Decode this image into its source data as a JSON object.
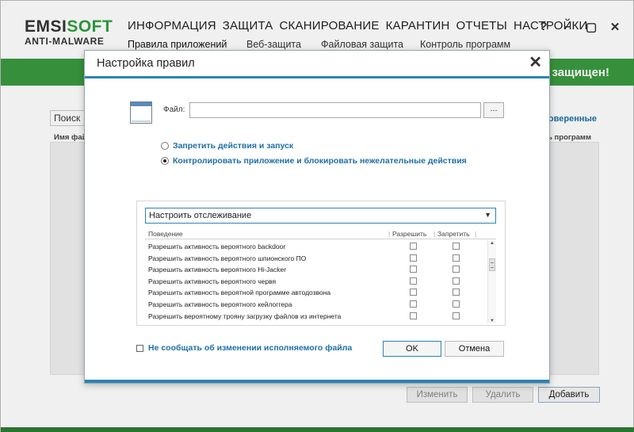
{
  "app": {
    "logo_main_a": "EMSI",
    "logo_main_b": "SOFT",
    "logo_sub": "ANTI-MALWARE",
    "main_nav": [
      "ИНФОРМАЦИЯ",
      "ЗАЩИТА",
      "СКАНИРОВАНИЕ",
      "КАРАНТИН",
      "ОТЧЕТЫ",
      "НАСТРОЙКИ"
    ],
    "sub_nav": [
      "Правила приложений",
      "Веб-защита",
      "Файловая защита",
      "Контроль программ"
    ],
    "window_controls": [
      "?",
      "–",
      "▢",
      "✕"
    ],
    "status_text": "защищен!",
    "search_value": "Поиск",
    "col_header_left": "Имя фай",
    "trusted_link": "доверенные",
    "col_header_right": "ль программ",
    "buttons": {
      "edit": "Изменить",
      "delete": "Удалить",
      "add": "Добавить"
    }
  },
  "dialog": {
    "title": "Настройка правил",
    "close_icon": "✕",
    "file_label": "Файл:",
    "file_value": "",
    "browse_label": "...",
    "radio_block": "Запретить действия и запуск",
    "radio_control": "Контролировать приложение и блокировать нежелательные действия",
    "selected_radio": "control",
    "select_value": "Настроить отслеживание",
    "columns": {
      "behavior": "Поведение",
      "allow": "Разрешить",
      "deny": "Запретить"
    },
    "rows": [
      "Разрешить активность вероятного backdoor",
      "Разрешить активность вероятного шпионского ПО",
      "Разрешить активность вероятного Hi-Jacker",
      "Разрешить активность вероятного червя",
      "Разрешить активность вероятной программе автодозвона",
      "Разрешить активность вероятного кейлоггера",
      "Разрешить вероятному трояну загрузку файлов из интернета"
    ],
    "notify_label": "Не сообщать об изменении исполняемого файла",
    "ok_label": "OK",
    "cancel_label": "Отмена"
  },
  "colors": {
    "brand_green": "#3a9a3f",
    "accent_blue": "#2a84b5",
    "link_blue": "#1e6fa6"
  },
  "icons": {
    "file_icon": "window-icon",
    "select_chevron": "chevron-down-icon"
  }
}
